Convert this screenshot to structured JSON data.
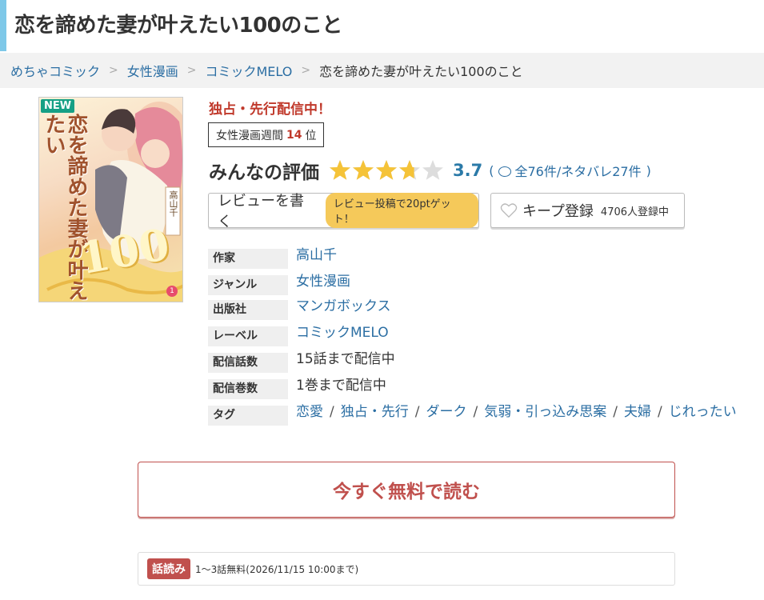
{
  "page": {
    "title": "恋を諦めた妻が叶えたい100のこと"
  },
  "breadcrumb": {
    "items": [
      "めちゃコミック",
      "女性漫画",
      "コミックMELO"
    ],
    "current": "恋を諦めた妻が叶えたい100のこと"
  },
  "cover": {
    "new_badge": "NEW",
    "title": "恋を諦めた妻が叶えたい",
    "number": "100",
    "author": "高山千",
    "volume": "1"
  },
  "product": {
    "exclusive_label": "独占・先行配信中！",
    "rank": {
      "prefix": "女性漫画週間",
      "number": "14",
      "suffix": "位"
    }
  },
  "rating": {
    "label": "みんなの評価",
    "value": 3.7,
    "score_text": "3.7",
    "stars_total": 5,
    "open_paren": "(",
    "counts_text": "全76件/ネタバレ27件",
    "close_paren": ")"
  },
  "actions": {
    "review_label": "レビューを書く",
    "review_reward": "レビュー投稿で20ptゲット！",
    "keep_label": "キープ登録",
    "keep_count": "4706人登録中"
  },
  "info": {
    "author_key": "作家",
    "author": "高山千",
    "genre_key": "ジャンル",
    "genre": "女性漫画",
    "publisher_key": "出版社",
    "publisher": "マンガボックス",
    "label_key": "レーベル",
    "label": "コミックMELO",
    "episodes_key": "配信話数",
    "episodes": "15話まで配信中",
    "volumes_key": "配信巻数",
    "volumes": "1巻まで配信中",
    "tags_key": "タグ",
    "tags": [
      "恋愛",
      "独占・先行",
      "ダーク",
      "気弱・引っ込み思案",
      "夫婦",
      "じれったい"
    ],
    "tag_separator": "/"
  },
  "cta": {
    "read_free": "今すぐ無料で読む"
  },
  "free_note": {
    "badge": "話読み",
    "text": "1～3話無料(2026/11/15 10:00まで)"
  },
  "colors": {
    "accent": "#7ec8e8",
    "link": "#2b6ea3",
    "star": "#f5c338",
    "cta": "#c0504d",
    "highlight": "#c0392b"
  }
}
